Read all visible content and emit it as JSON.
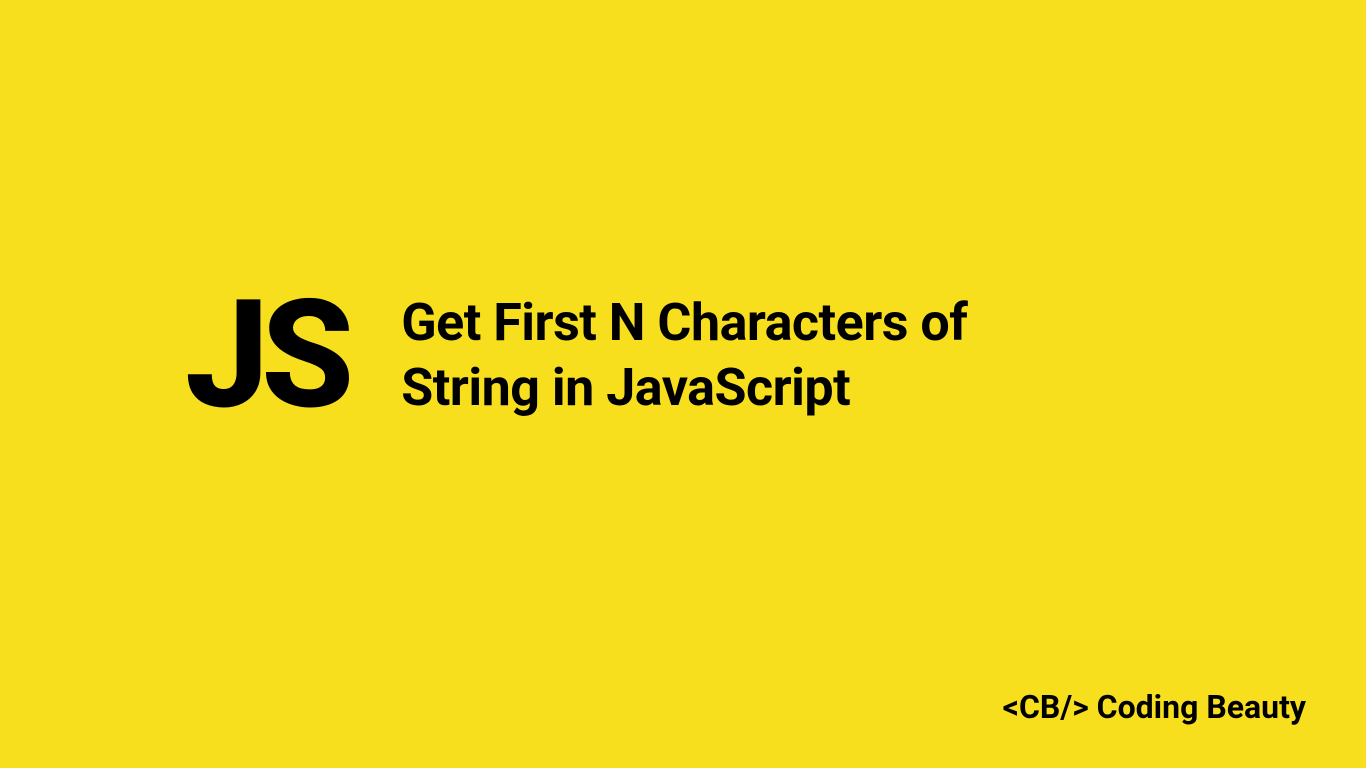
{
  "logo": {
    "text": "JS"
  },
  "title": {
    "line1": "Get First N Characters of",
    "line2": "String in JavaScript"
  },
  "brand": {
    "text": "<CB/> Coding Beauty"
  },
  "colors": {
    "background": "#f7df1e",
    "text": "#000000"
  }
}
